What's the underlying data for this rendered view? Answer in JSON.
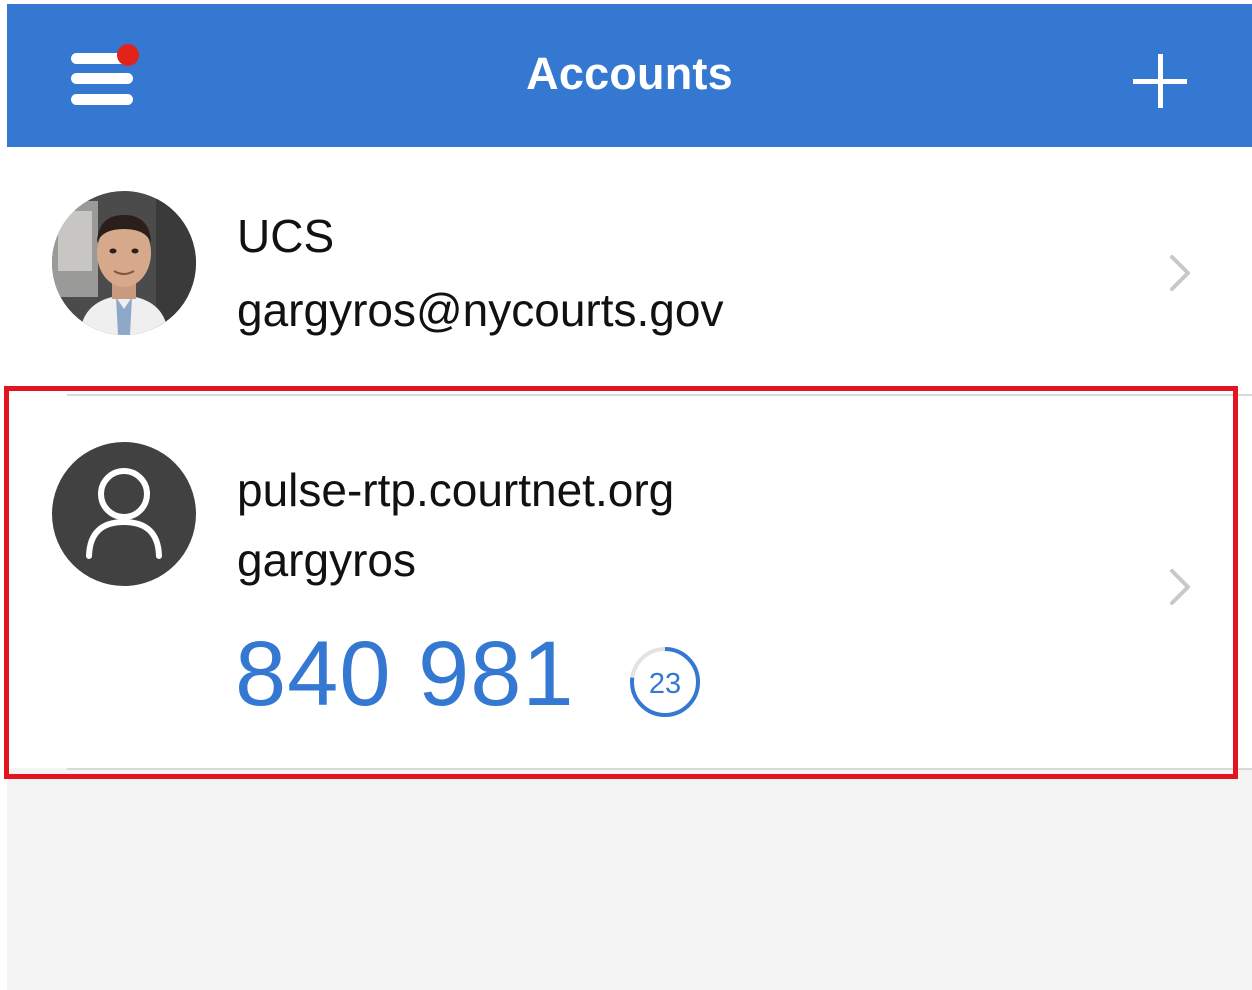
{
  "header": {
    "title": "Accounts",
    "menu_icon": "hamburger-menu-icon",
    "notification_color": "#e2231a",
    "add_icon": "plus-icon",
    "background_color": "#3478d1"
  },
  "accounts": [
    {
      "name": "UCS",
      "username": "gargyros@nycourts.gov",
      "avatar": "profile-photo"
    },
    {
      "name": "pulse-rtp.courtnet.org",
      "username": "gargyros",
      "avatar": "default-user-icon",
      "code": "840 981",
      "seconds_remaining": "23",
      "timer_fraction_remaining": 0.77,
      "highlighted": true,
      "highlight_color": "#e3141f"
    }
  ],
  "code_color": "#3478d1"
}
